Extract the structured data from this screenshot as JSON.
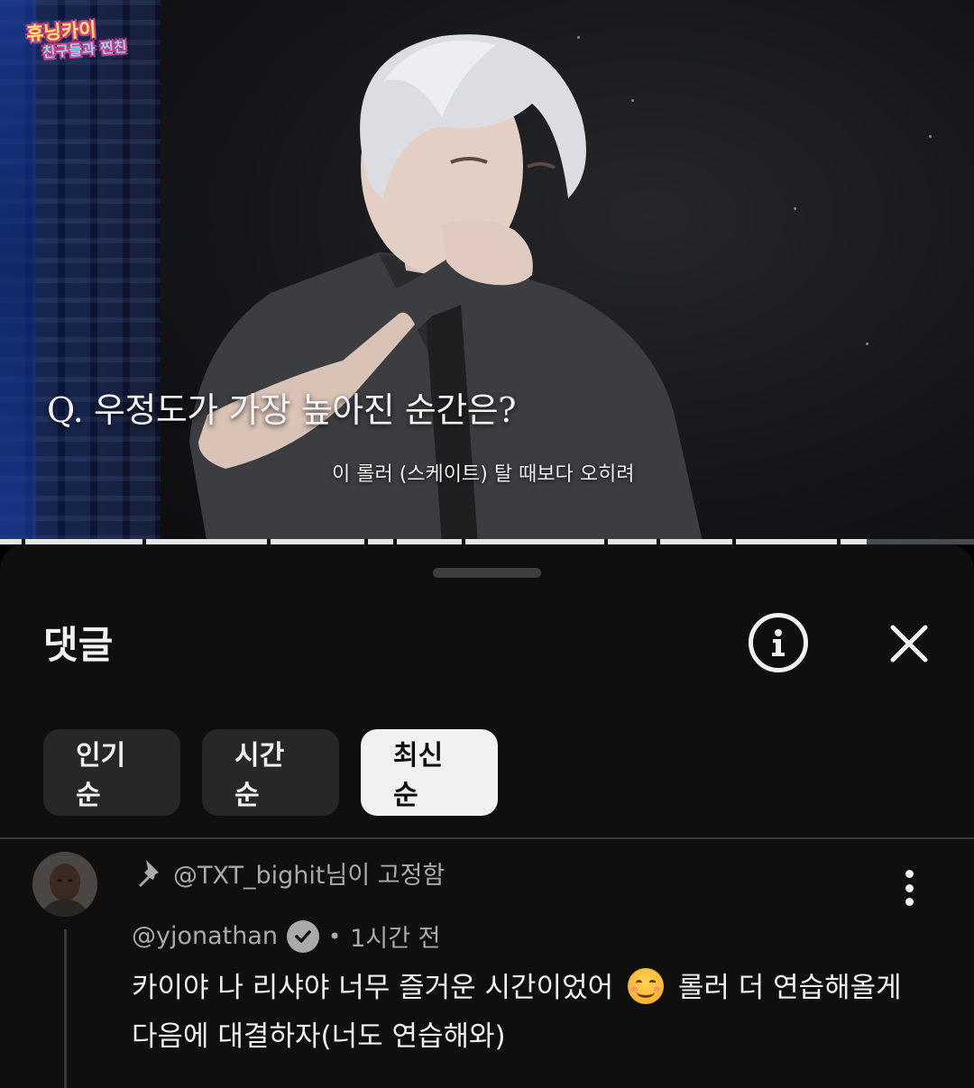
{
  "video": {
    "logo_line1": "휴닝카이",
    "logo_line2": "친구들과 찐친",
    "question_caption": "Q. 우정도가 가장 높아진 순간은?",
    "subtitle": "이 롤러 (스케이트) 탈 때보다 오히려",
    "progress_fraction": 0.89
  },
  "comments_sheet": {
    "title": "댓글",
    "info_icon": "info-circle-icon",
    "close_icon": "close-icon",
    "sort_chips": [
      {
        "label": "인기순",
        "active": false
      },
      {
        "label": "시간순",
        "active": false
      },
      {
        "label": "최신순",
        "active": true
      }
    ]
  },
  "comment": {
    "pinned_text": "@TXT_bighit님이 고정함",
    "author": "@yjonathan",
    "verified": true,
    "separator": "•",
    "time": "1시간 전",
    "body_part1": "카이야 나 리샤야 너무 즐거운 시간이었어",
    "emoji": "smiling-face-emoji",
    "body_part2": "롤러 더 연습해올게",
    "body_line2": "다음에 대결하자(너도 연습해와)"
  },
  "colors": {
    "sheet_bg": "#0f0f0f",
    "chip_bg": "#272727",
    "chip_active_bg": "#f1f1f1",
    "text_primary": "#f1f1f1",
    "text_secondary": "#aaaaaa"
  }
}
